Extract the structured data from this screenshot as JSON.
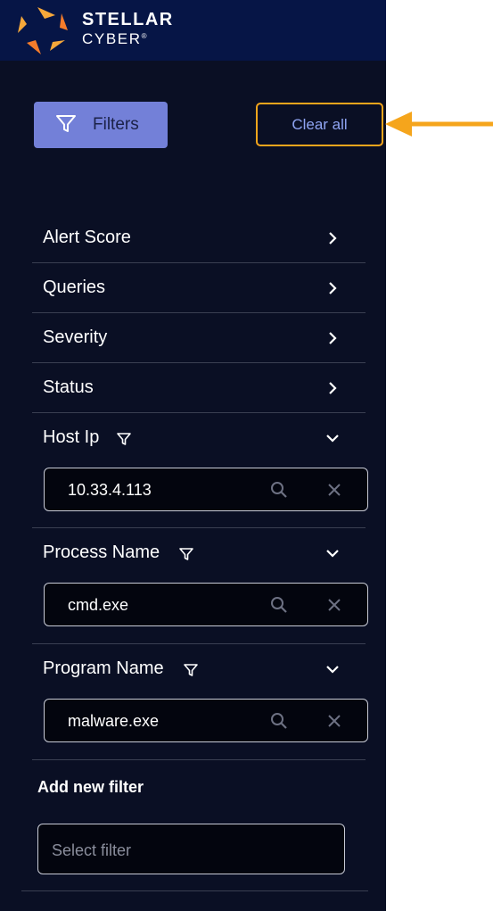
{
  "brand": {
    "line1": "STELLAR",
    "line2": "CYBER",
    "reg": "®",
    "colors": {
      "orange": "#f57c2b",
      "gold": "#f7a83a"
    }
  },
  "toolbar": {
    "filters_label": "Filters",
    "clear_all_label": "Clear all"
  },
  "annotation": {
    "arrow_color": "#f5a51c"
  },
  "sections": [
    {
      "label": "Alert Score",
      "state": "collapsed"
    },
    {
      "label": "Queries",
      "state": "collapsed"
    },
    {
      "label": "Severity",
      "state": "collapsed"
    },
    {
      "label": "Status",
      "state": "collapsed"
    }
  ],
  "active_filters": [
    {
      "label": "Host Ip",
      "value": "10.33.4.113"
    },
    {
      "label": "Process Name",
      "value": "cmd.exe"
    },
    {
      "label": "Program Name",
      "value": "malware.exe"
    }
  ],
  "add_filter": {
    "title": "Add new filter",
    "placeholder": "Select filter"
  }
}
